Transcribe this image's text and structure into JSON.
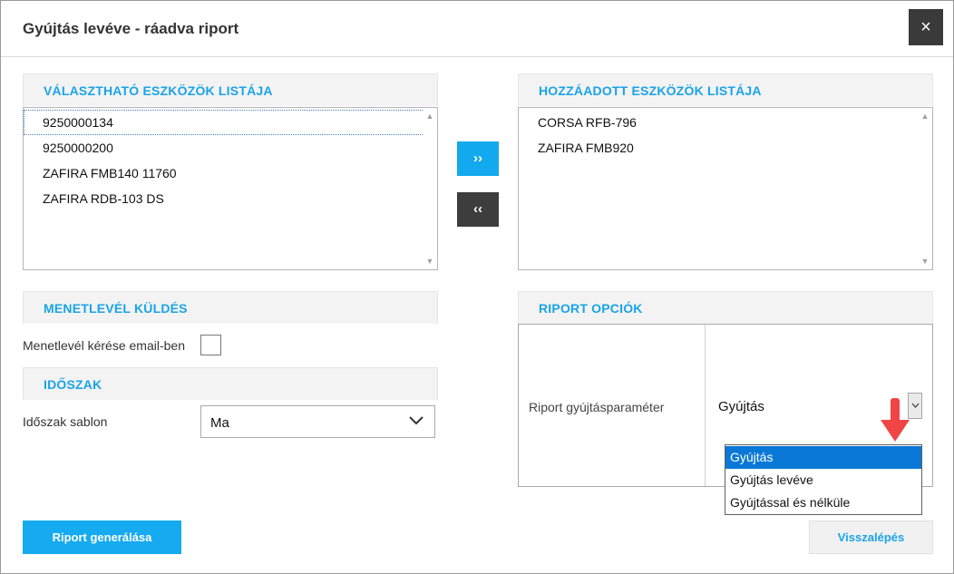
{
  "dialog": {
    "title": "Gyújtás levéve - ráadva riport",
    "close_glyph": "×"
  },
  "available": {
    "header": "VÁLASZTHATÓ ESZKÖZÖK LISTÁJA",
    "items": [
      "9250000134",
      "9250000200",
      "ZAFIRA FMB140 11760",
      "ZAFIRA RDB-103 DS"
    ]
  },
  "added": {
    "header": "HOZZÁADOTT ESZKÖZÖK LISTÁJA",
    "items": [
      "CORSA RFB-796",
      "ZAFIRA FMB920"
    ]
  },
  "transfer": {
    "add_glyph": "››",
    "remove_glyph": "‹‹"
  },
  "waybill": {
    "header": "MENETLEVÉL KÜLDÉS",
    "email_label": "Menetlevél kérése email-ben",
    "email_checked": false
  },
  "period": {
    "header": "IDŐSZAK",
    "template_label": "Időszak sablon",
    "template_value": "Ma"
  },
  "report_options": {
    "header": "RIPORT OPCIÓK",
    "param_label": "Riport gyújtásparaméter",
    "param_value": "Gyújtás",
    "options": [
      "Gyújtás",
      "Gyújtás levéve",
      "Gyújtással és nélküle"
    ],
    "selected_index": 0
  },
  "footer": {
    "generate_label": "Riport generálása",
    "back_label": "Visszalépés"
  },
  "colors": {
    "accent": "#16aaf0",
    "header_text": "#1aa3e8",
    "dark_button": "#3d3d3d",
    "selected_option": "#0a78d7",
    "annotation_arrow": "#f04545"
  },
  "icons": {
    "close": "close-icon",
    "dropdown": "chevron-down-icon",
    "annotation": "red-arrow-icon"
  }
}
